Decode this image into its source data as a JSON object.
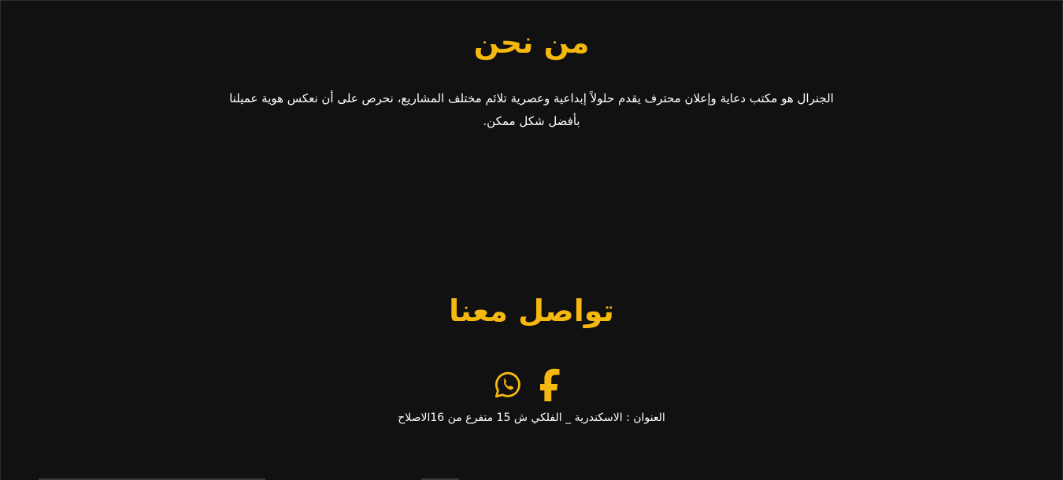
{
  "about": {
    "title": "من نحن",
    "text": "الجنرال هو مكتب دعاية وإعلان محترف يقدم حلولاً إبداعية وعصرية تلائم مختلف المشاريع، نحرص على أن نعكس هوية عميلنا بأفضل شكل ممكن."
  },
  "contact": {
    "title": "تواصل معنا",
    "address": "العنوان : الاسكندرية _ الفلكي ش 15 متفرع من 16الاصلاح",
    "socials": [
      {
        "name": "whatsapp",
        "icon": "whatsapp-icon"
      },
      {
        "name": "facebook",
        "icon": "facebook-icon"
      }
    ]
  },
  "theme": {
    "background": "#111111",
    "accent": "#f5b80f",
    "text": "#ffffff"
  }
}
